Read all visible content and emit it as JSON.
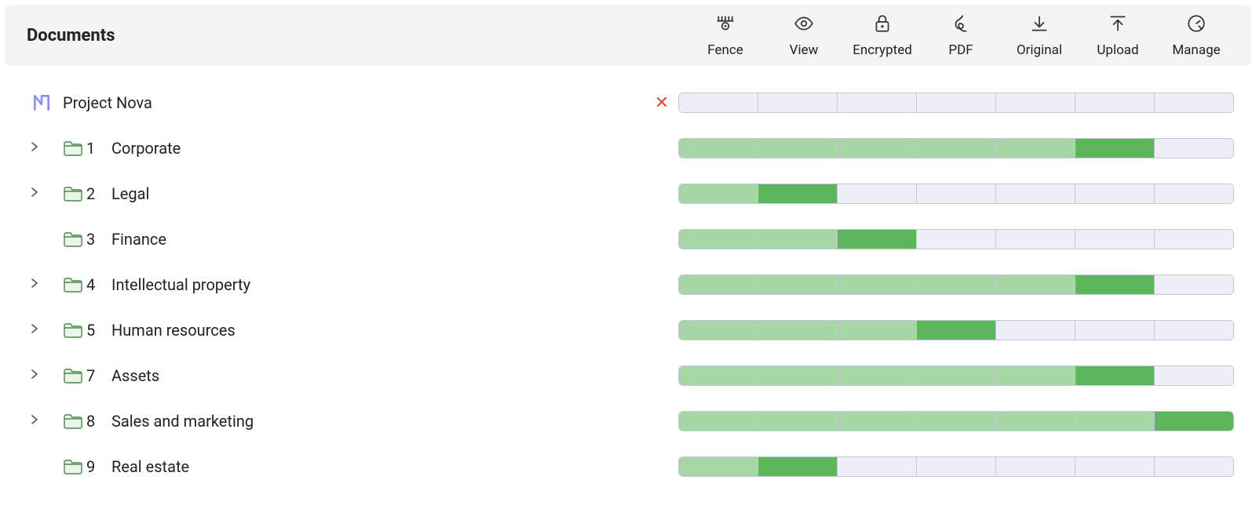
{
  "header": {
    "title": "Documents",
    "actions": [
      {
        "key": "fence",
        "label": "Fence"
      },
      {
        "key": "view",
        "label": "View"
      },
      {
        "key": "encrypted",
        "label": "Encrypted"
      },
      {
        "key": "pdf",
        "label": "PDF"
      },
      {
        "key": "original",
        "label": "Original"
      },
      {
        "key": "upload",
        "label": "Upload"
      },
      {
        "key": "manage",
        "label": "Manage"
      }
    ]
  },
  "root": {
    "name": "Project Nova",
    "close_label": "✕",
    "permissions": [
      "empty",
      "empty",
      "empty",
      "empty",
      "empty",
      "empty",
      "empty"
    ]
  },
  "folders": [
    {
      "expandable": true,
      "index": "1",
      "name": "Corporate",
      "permissions": [
        "light",
        "light",
        "light",
        "light",
        "light",
        "dark",
        "empty"
      ]
    },
    {
      "expandable": true,
      "index": "2",
      "name": "Legal",
      "permissions": [
        "light",
        "dark",
        "empty",
        "empty",
        "empty",
        "empty",
        "empty"
      ]
    },
    {
      "expandable": false,
      "index": "3",
      "name": "Finance",
      "permissions": [
        "light",
        "light",
        "dark",
        "empty",
        "empty",
        "empty",
        "empty"
      ]
    },
    {
      "expandable": true,
      "index": "4",
      "name": "Intellectual property",
      "permissions": [
        "light",
        "light",
        "light",
        "light",
        "light",
        "dark",
        "empty"
      ]
    },
    {
      "expandable": true,
      "index": "5",
      "name": "Human resources",
      "permissions": [
        "light",
        "light",
        "light",
        "dark",
        "empty",
        "empty",
        "empty"
      ]
    },
    {
      "expandable": true,
      "index": "7",
      "name": "Assets",
      "permissions": [
        "light",
        "light",
        "light",
        "light",
        "light",
        "dark",
        "empty"
      ]
    },
    {
      "expandable": true,
      "index": "8",
      "name": "Sales and marketing",
      "permissions": [
        "light",
        "light",
        "light",
        "light",
        "light",
        "light",
        "dark"
      ]
    },
    {
      "expandable": false,
      "index": "9",
      "name": "Real estate",
      "permissions": [
        "light",
        "dark",
        "empty",
        "empty",
        "empty",
        "empty",
        "empty"
      ]
    }
  ],
  "colors": {
    "light_green": "#a4d7a4",
    "dark_green": "#5cb75c",
    "empty": "#eceff6"
  }
}
